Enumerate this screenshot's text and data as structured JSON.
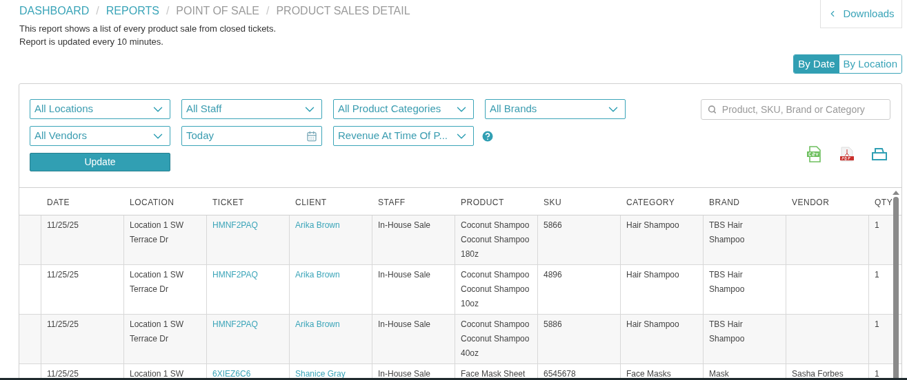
{
  "breadcrumb": [
    {
      "label": "DASHBOARD",
      "link": true
    },
    {
      "label": "REPORTS",
      "link": true
    },
    {
      "label": "POINT OF SALE",
      "link": false
    },
    {
      "label": "PRODUCT SALES DETAIL",
      "link": false
    }
  ],
  "breadcrumb_separator": "/",
  "description": [
    "This report shows a list of every product sale from closed tickets.",
    "Report is updated every 10 minutes."
  ],
  "downloads_button": {
    "label": "Downloads"
  },
  "view_toggle": [
    {
      "label": "By Date",
      "selected": true
    },
    {
      "label": "By Location",
      "selected": false
    }
  ],
  "filters": [
    {
      "kind": "select",
      "value": "All Locations"
    },
    {
      "kind": "select",
      "value": "All Staff"
    },
    {
      "kind": "select",
      "value": "All Product Categories"
    },
    {
      "kind": "select",
      "value": "All Brands"
    },
    {
      "kind": "select",
      "value": "All Vendors"
    },
    {
      "kind": "date",
      "value": "Today"
    },
    {
      "kind": "select",
      "value": "Revenue At Time Of P..."
    }
  ],
  "search": {
    "placeholder": "Product, SKU, Brand or Category"
  },
  "update_button": {
    "label": "Update"
  },
  "table": {
    "columns": [
      {
        "label": "DATE",
        "kind": "text"
      },
      {
        "label": "LOCATION",
        "kind": "text"
      },
      {
        "label": "TICKET",
        "kind": "link"
      },
      {
        "label": "CLIENT",
        "kind": "link"
      },
      {
        "label": "STAFF",
        "kind": "text"
      },
      {
        "label": "PRODUCT",
        "kind": "text"
      },
      {
        "label": "SKU",
        "kind": "text"
      },
      {
        "label": "CATEGORY",
        "kind": "text"
      },
      {
        "label": "BRAND",
        "kind": "text"
      },
      {
        "label": "VENDOR",
        "kind": "text"
      },
      {
        "label": "QTY",
        "kind": "text"
      }
    ],
    "rows": [
      [
        "11/25/25",
        "Location 1 SW Terrace Dr",
        "HMNF2PAQ",
        "Arika Brown",
        "In-House Sale",
        "Coconut Shampoo Coconut Shampoo 180z",
        "5866",
        "Hair Shampoo",
        "TBS Hair Shampoo",
        "",
        "1"
      ],
      [
        "11/25/25",
        "Location 1 SW Terrace Dr",
        "HMNF2PAQ",
        "Arika Brown",
        "In-House Sale",
        "Coconut Shampoo Coconut Shampoo 10oz",
        "4896",
        "Hair Shampoo",
        "TBS Hair Shampoo",
        "",
        "1"
      ],
      [
        "11/25/25",
        "Location 1 SW Terrace Dr",
        "HMNF2PAQ",
        "Arika Brown",
        "In-House Sale",
        "Coconut Shampoo Coconut Shampoo 40oz",
        "5886",
        "Hair Shampoo",
        "TBS Hair Shampoo",
        "",
        "1"
      ],
      [
        "11/25/25",
        "Location 1 SW",
        "6XIEZ6C6",
        "Shanice Gray",
        "In-House Sale",
        "Face Mask Sheet",
        "6545678",
        "Face Masks",
        "Mask",
        "Sasha Forbes",
        "1"
      ]
    ]
  }
}
